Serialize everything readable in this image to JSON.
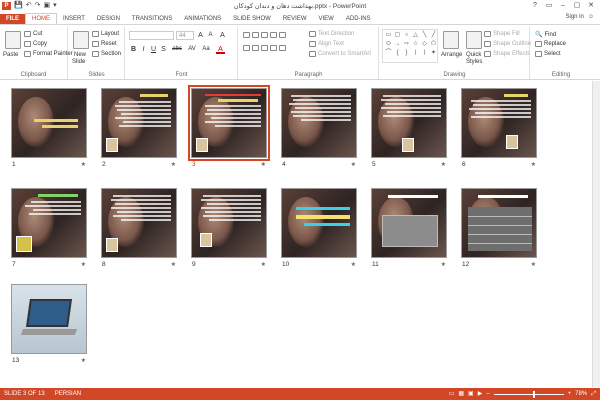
{
  "app": {
    "title": "بهداشت دهان و دندان کودکان.pptx - PowerPoint",
    "logo_letter": "P"
  },
  "window": {
    "help": "?",
    "ribbon_display": "▭",
    "minimize": "–",
    "maximize": "▢",
    "close": "✕"
  },
  "qat": {
    "save": "💾",
    "undo": "↶",
    "redo": "↷",
    "start": "▣",
    "customize": "▾"
  },
  "tabs": [
    {
      "label": "FILE"
    },
    {
      "label": "HOME"
    },
    {
      "label": "INSERT"
    },
    {
      "label": "DESIGN"
    },
    {
      "label": "TRANSITIONS"
    },
    {
      "label": "ANIMATIONS"
    },
    {
      "label": "SLIDE SHOW"
    },
    {
      "label": "REVIEW"
    },
    {
      "label": "VIEW"
    },
    {
      "label": "ADD-INS"
    }
  ],
  "account": {
    "signin": "Sign in",
    "avatar": "☺"
  },
  "ribbon": {
    "clipboard": {
      "paste": "Paste",
      "cut": "Cut",
      "copy": "Copy",
      "format_painter": "Format Painter",
      "label": "Clipboard"
    },
    "slides": {
      "new_slide": "New",
      "new_slide2": "Slide",
      "layout": "Layout",
      "reset": "Reset",
      "section": "Section",
      "label": "Slides"
    },
    "font": {
      "font_name": "",
      "font_size": "44",
      "grow": "A",
      "shrink": "A",
      "clear": "A",
      "bold": "B",
      "italic": "I",
      "underline": "U",
      "strike": "S",
      "abc": "abc",
      "spacing": "AV",
      "case": "Aa",
      "color": "A",
      "label": "Font"
    },
    "paragraph": {
      "text_direction": "Text Direction",
      "align_text": "Align Text",
      "convert_smartart": "Convert to SmartArt",
      "label": "Paragraph"
    },
    "drawing": {
      "arrange": "Arrange",
      "quick_styles": "Quick",
      "quick_styles2": "Styles",
      "shape_fill": "Shape Fill",
      "shape_outline": "Shape Outline",
      "shape_effects": "Shape Effects",
      "label": "Drawing"
    },
    "editing": {
      "find": "Find",
      "replace": "Replace",
      "select": "Select",
      "label": "Editing"
    }
  },
  "shapes": [
    "▭",
    "▢",
    "○",
    "△",
    "╲",
    "╱",
    "⬭",
    "→",
    "⇨",
    "☆",
    "◇",
    "⬠",
    "⌒",
    "{",
    "}",
    "⟨",
    "⟩",
    "✦"
  ],
  "slides": [
    {
      "num": "1",
      "star": "★"
    },
    {
      "num": "2",
      "star": "★"
    },
    {
      "num": "3",
      "star": "★"
    },
    {
      "num": "4",
      "star": "★"
    },
    {
      "num": "5",
      "star": "★"
    },
    {
      "num": "6",
      "star": "★"
    },
    {
      "num": "7",
      "star": "★"
    },
    {
      "num": "8",
      "star": "★"
    },
    {
      "num": "9",
      "star": "★"
    },
    {
      "num": "10",
      "star": "★"
    },
    {
      "num": "11",
      "star": "★"
    },
    {
      "num": "12",
      "star": "★"
    },
    {
      "num": "13",
      "star": "★"
    }
  ],
  "selected_slide": 3,
  "status": {
    "slide_info": "SLIDE 3 OF 13",
    "language": "PERSIAN",
    "zoom": "78%",
    "zoom_level": 0.56,
    "zoom_minus": "–",
    "zoom_plus": "+"
  },
  "colors": {
    "accent": "#D24726"
  }
}
